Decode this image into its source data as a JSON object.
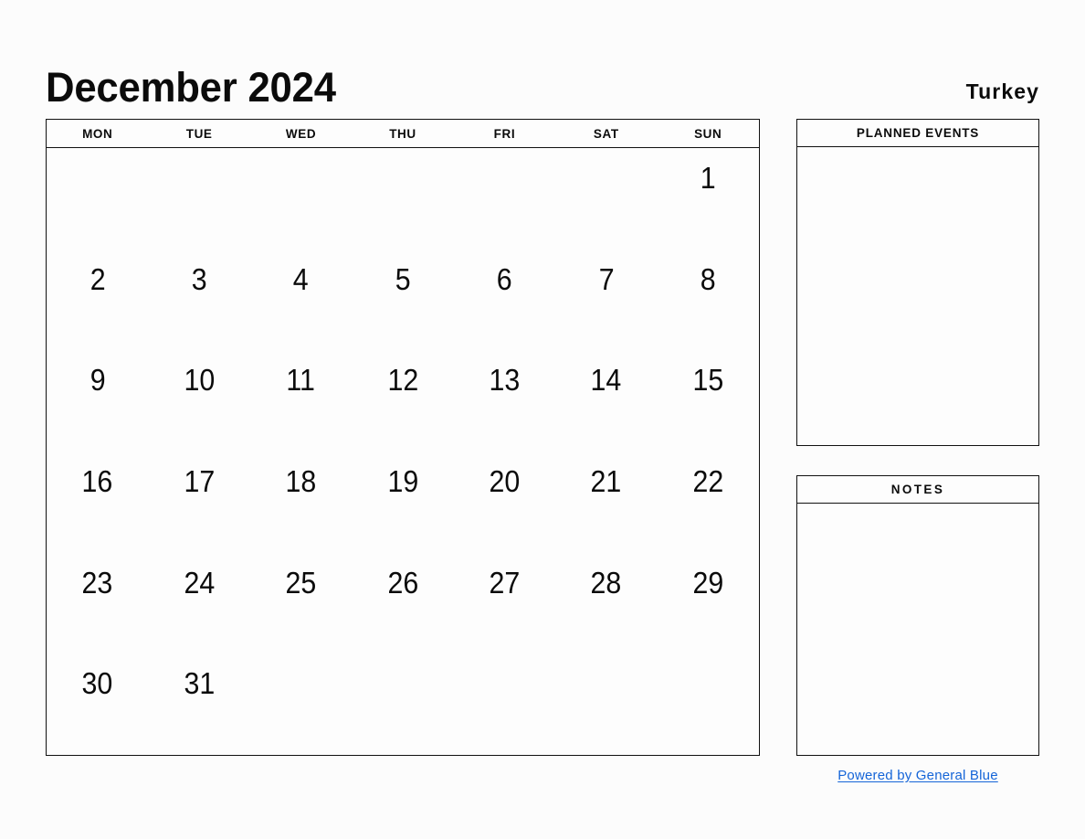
{
  "header": {
    "title": "December 2024",
    "country": "Turkey"
  },
  "calendar": {
    "weekdays": [
      "MON",
      "TUE",
      "WED",
      "THU",
      "FRI",
      "SAT",
      "SUN"
    ],
    "weeks": [
      [
        "",
        "",
        "",
        "",
        "",
        "",
        "1"
      ],
      [
        "2",
        "3",
        "4",
        "5",
        "6",
        "7",
        "8"
      ],
      [
        "9",
        "10",
        "11",
        "12",
        "13",
        "14",
        "15"
      ],
      [
        "16",
        "17",
        "18",
        "19",
        "20",
        "21",
        "22"
      ],
      [
        "23",
        "24",
        "25",
        "26",
        "27",
        "28",
        "29"
      ],
      [
        "30",
        "31",
        "",
        "",
        "",
        "",
        ""
      ]
    ]
  },
  "panels": {
    "events": {
      "title": "PLANNED EVENTS",
      "content": ""
    },
    "notes": {
      "title": "NOTES",
      "content": ""
    }
  },
  "footer": {
    "link_text": "Powered by General Blue",
    "link_color": "#1565d8"
  }
}
